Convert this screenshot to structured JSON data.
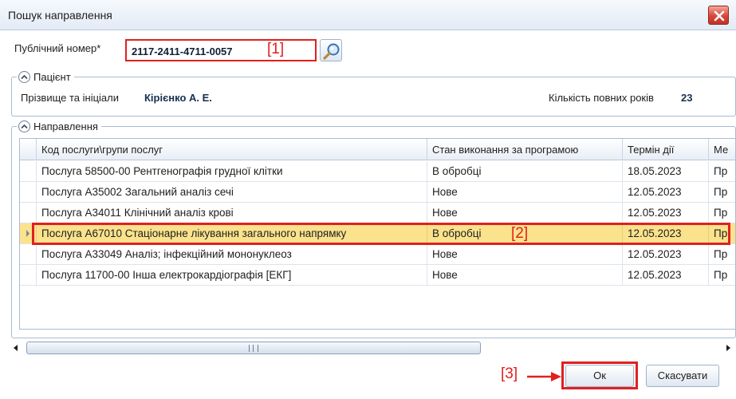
{
  "window": {
    "title": "Пошук направлення",
    "close_icon": "close-icon"
  },
  "public_number": {
    "label": "Публічний номер*",
    "value": "2117-2411-4711-0057",
    "marker": "[1]"
  },
  "patient": {
    "group_title": "Пацієнт",
    "name_label": "Прізвище та ініціали",
    "name_value": "Кірієнко А. Е.",
    "age_label": "Кількість повних років",
    "age_value": "23"
  },
  "referrals": {
    "group_title": "Направлення",
    "columns": [
      "Код послуги\\групи послуг",
      "Стан виконання за програмою",
      "Термін дії",
      "Ме"
    ],
    "rows": [
      {
        "service": "Послуга 58500-00 Рентгенографія грудної клітки",
        "status": "В обробці",
        "term": "18.05.2023",
        "extra": "Пр"
      },
      {
        "service": "Послуга A35002 Загальний аналіз сечі",
        "status": "Нове",
        "term": "12.05.2023",
        "extra": "Пр"
      },
      {
        "service": "Послуга A34011 Клінічний аналіз крові",
        "status": "Нове",
        "term": "12.05.2023",
        "extra": "Пр"
      },
      {
        "service": "Послуга A67010 Стаціонарне лікування загального напрямку",
        "status": "В обробці",
        "term": "12.05.2023",
        "extra": "Пр"
      },
      {
        "service": "Послуга A33049 Аналіз; інфекційний мононуклеоз",
        "status": "Нове",
        "term": "12.05.2023",
        "extra": "Пр"
      },
      {
        "service": "Послуга 11700-00 Інша електрокардіографія [ЕКГ]",
        "status": "Нове",
        "term": "12.05.2023",
        "extra": "Пр"
      }
    ],
    "selected_marker": "[2]"
  },
  "footer": {
    "ok_label": "Ок",
    "cancel_label": "Скасувати",
    "marker": "[3]"
  },
  "colors": {
    "highlight": "#e02020",
    "selected_row": "#fbe28c"
  }
}
